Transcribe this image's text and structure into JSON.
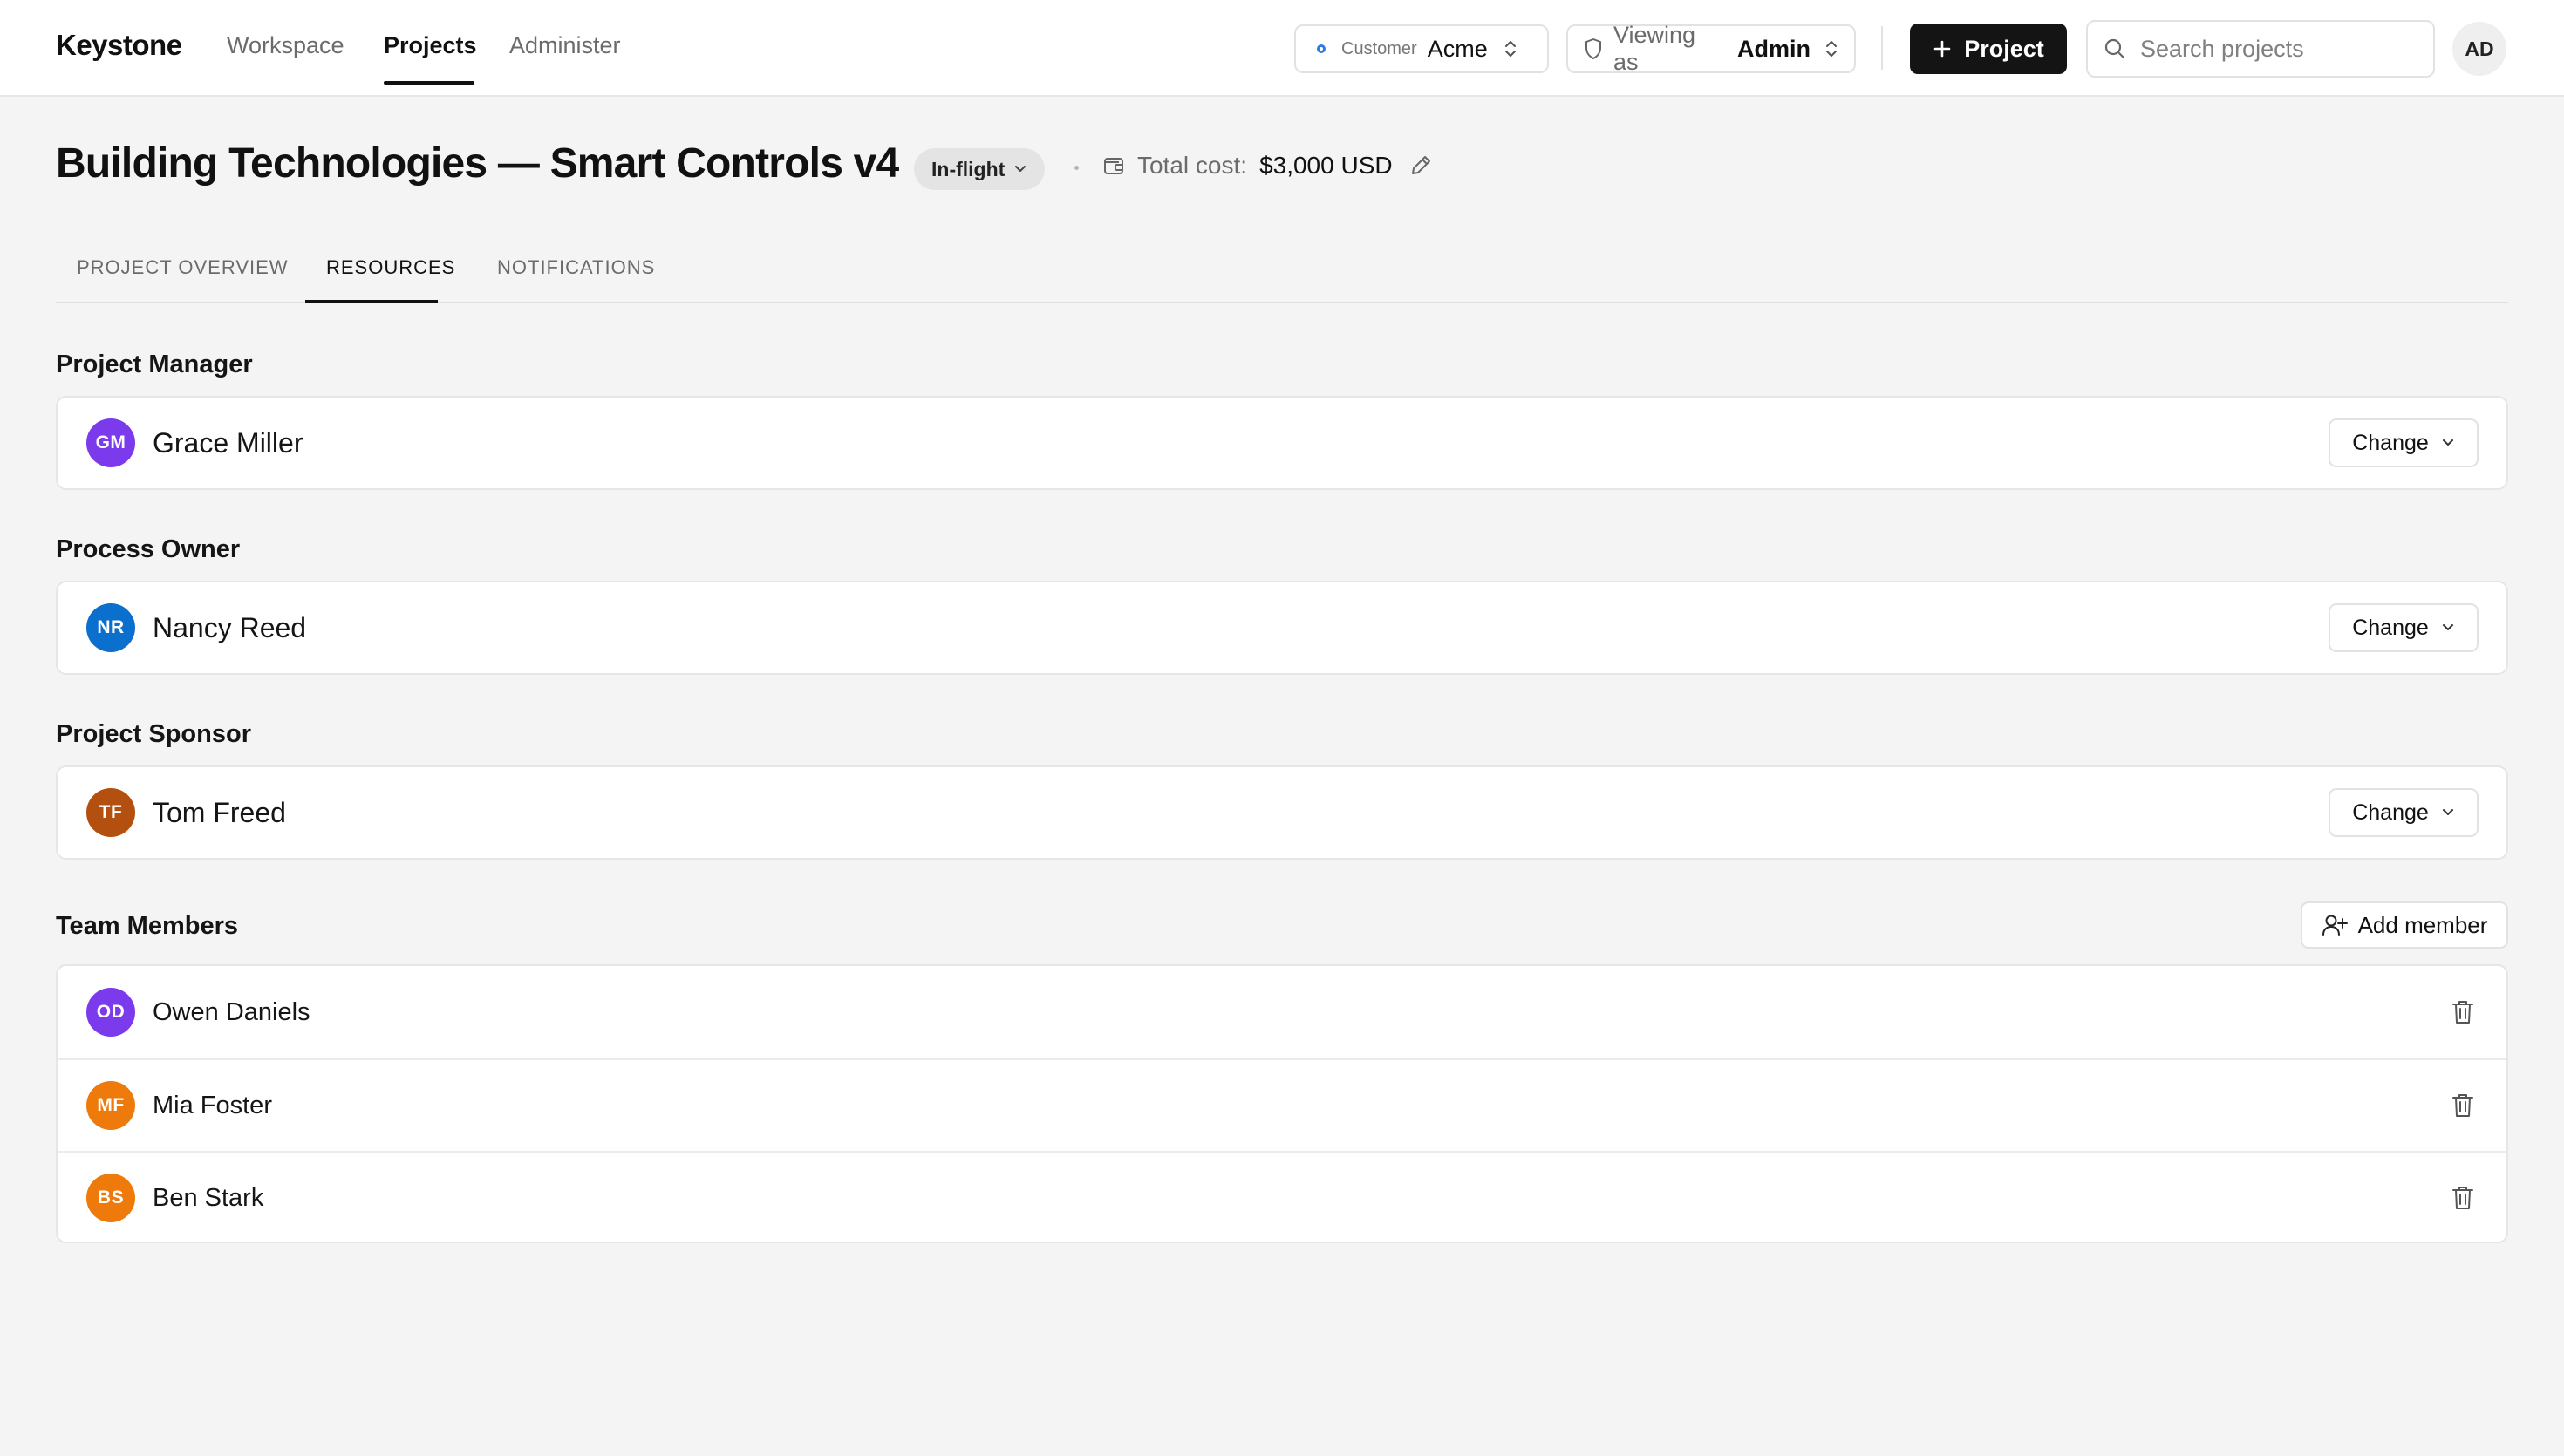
{
  "app": {
    "brand": "Keystone",
    "nav": [
      "Workspace",
      "Projects",
      "Administer"
    ],
    "active_nav": "Projects"
  },
  "header": {
    "customer_label": "Customer",
    "customer_value": "Acme",
    "viewing_label": "Viewing as",
    "viewing_value": "Admin",
    "new_project_label": "Project",
    "search_placeholder": "Search projects",
    "user_initials": "AD"
  },
  "project": {
    "title": "Building Technologies — Smart Controls v4",
    "status": "In-flight",
    "cost_label": "Total cost:",
    "cost_value": "$3,000 USD"
  },
  "tabs": [
    "PROJECT OVERVIEW",
    "RESOURCES",
    "NOTIFICATIONS"
  ],
  "active_tab": "RESOURCES",
  "roles": [
    {
      "title": "Project Manager",
      "initials": "GM",
      "name": "Grace Miller",
      "color": "#7c3aed",
      "action": "Change"
    },
    {
      "title": "Process Owner",
      "initials": "NR",
      "name": "Nancy Reed",
      "color": "#0b6fce",
      "action": "Change"
    },
    {
      "title": "Project Sponsor",
      "initials": "TF",
      "name": "Tom Freed",
      "color": "#b4500f",
      "action": "Change"
    }
  ],
  "team": {
    "title": "Team Members",
    "add_label": "Add member",
    "members": [
      {
        "initials": "OD",
        "name": "Owen Daniels",
        "color": "#7c3aed"
      },
      {
        "initials": "MF",
        "name": "Mia Foster",
        "color": "#ee7a0c"
      },
      {
        "initials": "BS",
        "name": "Ben Stark",
        "color": "#ee7a0c"
      }
    ]
  }
}
